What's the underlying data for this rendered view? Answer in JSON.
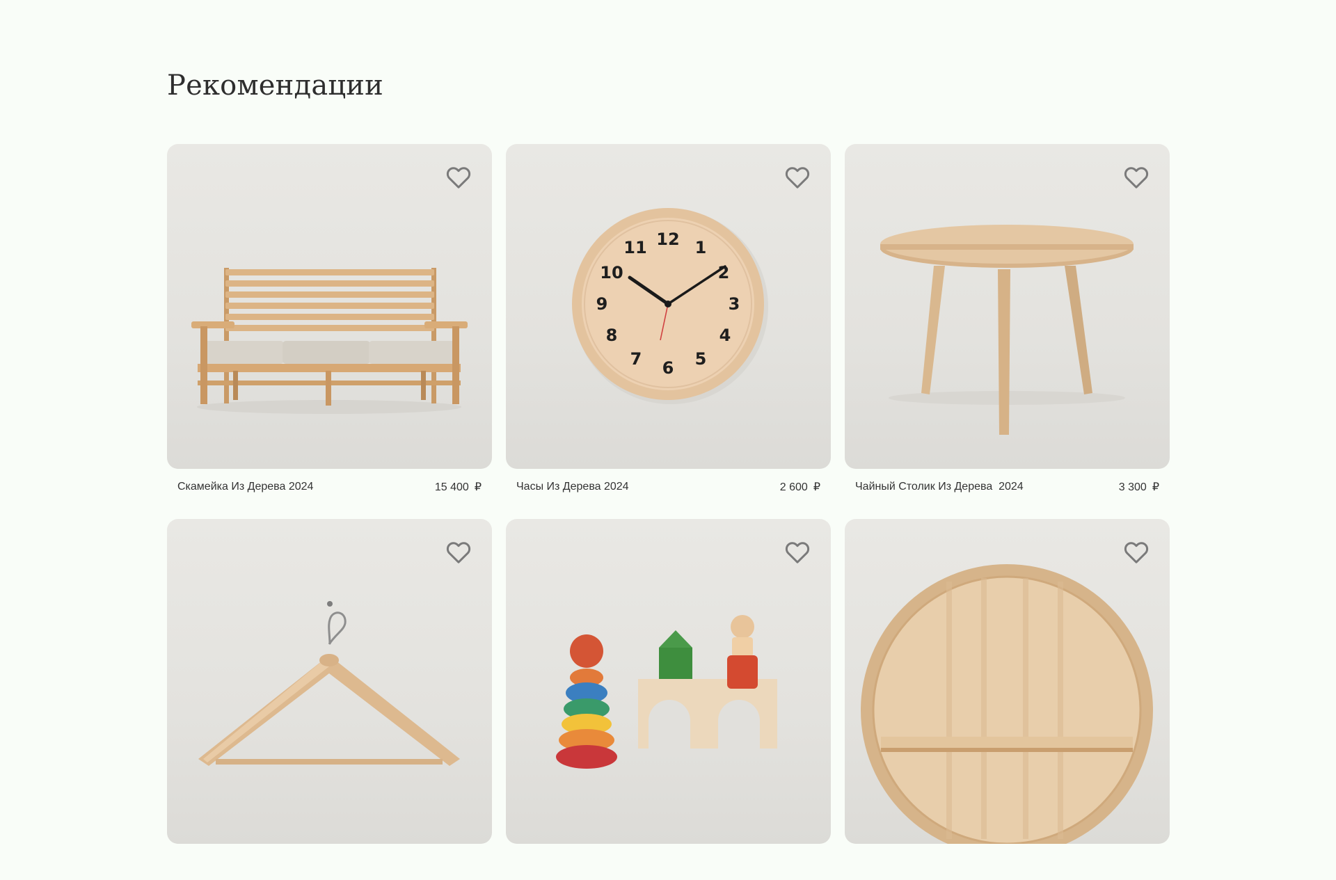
{
  "page": {
    "title": "Рекомендации"
  },
  "products": [
    {
      "name": "Скамейка Из Дерева 2024",
      "price": "15 400",
      "currency": "₽",
      "image": "wooden-bench"
    },
    {
      "name": "Часы Из Дерева 2024",
      "price": "2 600",
      "currency": "₽",
      "image": "wooden-clock"
    },
    {
      "name": "Чайный Столик Из Дерева  2024",
      "price": "3 300",
      "currency": "₽",
      "image": "wooden-coffee-table"
    },
    {
      "name": "",
      "price": "",
      "currency": "",
      "image": "wooden-hanger"
    },
    {
      "name": "",
      "price": "",
      "currency": "",
      "image": "wooden-toys"
    },
    {
      "name": "",
      "price": "",
      "currency": "",
      "image": "round-wooden-shelf"
    }
  ],
  "icons": {
    "favorite": "heart-outline-icon"
  },
  "colors": {
    "background": "#f9fdf8",
    "text": "#2e2e2e",
    "wood": "#dcb88f",
    "heart": "#7a7a7a"
  }
}
